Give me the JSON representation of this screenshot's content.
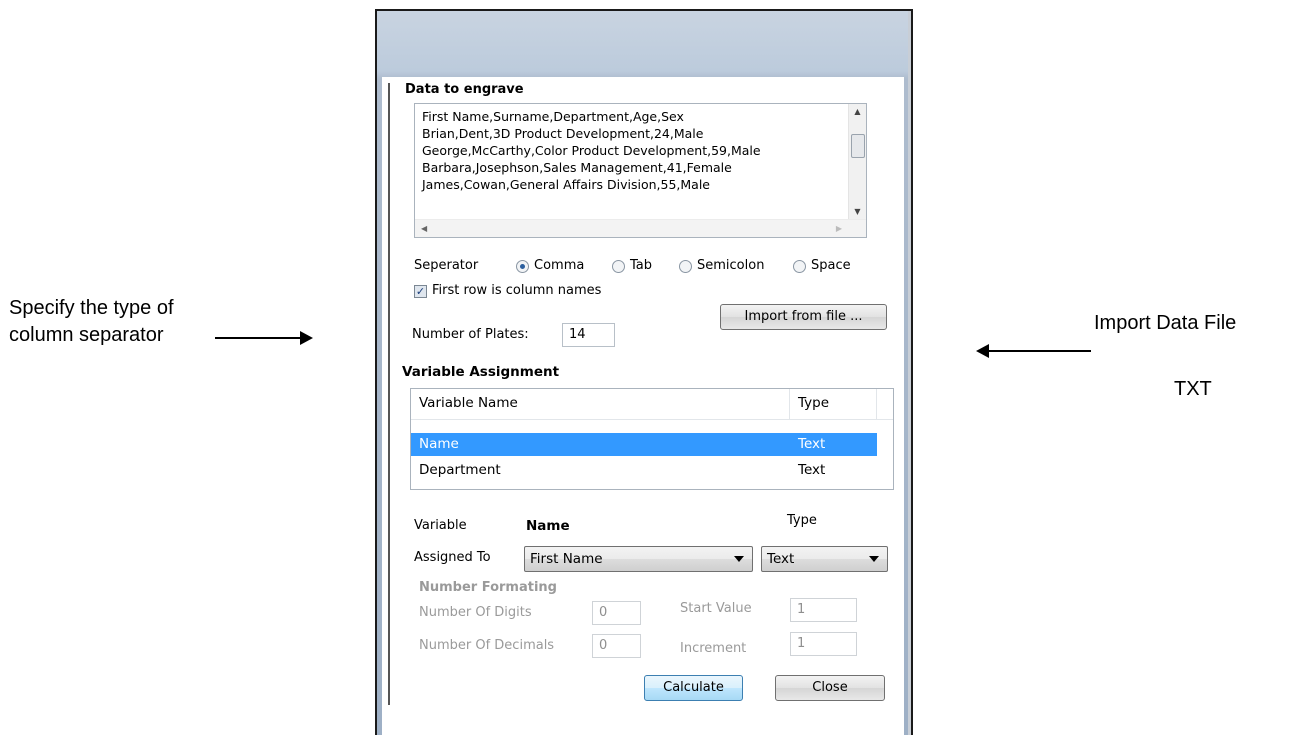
{
  "annotations": {
    "left_line1": "Specify the type of",
    "left_line2": "column separator",
    "right_line1": "Import Data File",
    "right_line2": "TXT"
  },
  "dialog": {
    "data_to_engrave_label": "Data to engrave",
    "data_lines": [
      "First Name,Surname,Department,Age,Sex",
      "Brian,Dent,3D Product Development,24,Male",
      "George,McCarthy,Color Product Development,59,Male",
      "Barbara,Josephson,Sales Management,41,Female",
      "James,Cowan,General Affairs Division,55,Male"
    ],
    "separator": {
      "label": "Seperator",
      "options": [
        "Comma",
        "Tab",
        "Semicolon",
        "Space"
      ],
      "selected": "Comma"
    },
    "first_row_checkbox": {
      "label": "First row is column names",
      "checked": true
    },
    "import_button": "Import from file ...",
    "plates": {
      "label": "Number of Plates:",
      "value": "14"
    },
    "variable_assignment": {
      "title": "Variable Assignment",
      "columns": [
        "Variable Name",
        "Type"
      ],
      "rows": [
        {
          "name": "Name",
          "type": "Text",
          "selected": true
        },
        {
          "name": "Department",
          "type": "Text",
          "selected": false
        }
      ]
    },
    "assign": {
      "variable_label": "Variable",
      "variable_value": "Name",
      "type_label": "Type",
      "assigned_to_label": "Assigned To",
      "assigned_to_value": "First Name",
      "type_value": "Text"
    },
    "number_formatting": {
      "title": "Number Formating",
      "digits_label": "Number Of Digits",
      "digits_value": "0",
      "decimals_label": "Number Of Decimals",
      "decimals_value": "0",
      "start_label": "Start Value",
      "start_value": "1",
      "increment_label": "Increment",
      "increment_value": "1"
    },
    "calculate_button": "Calculate",
    "close_button": "Close"
  }
}
